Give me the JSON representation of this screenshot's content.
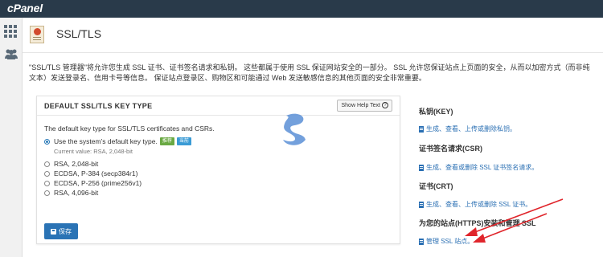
{
  "topbar": {
    "logo": "cPanel"
  },
  "header": {
    "title": "SSL/TLS"
  },
  "description": "\"SSL/TLS 管理器\"将允许您生成 SSL 证书、证书签名请求和私钥。 这些都属于使用 SSL 保证网站安全的一部分。 SSL 允许您保证站点上页面的安全，从而以加密方式（而非纯文本）发送登录名、信用卡号等信息。 保证站点登录区、购物区和可能通过 Web 发送敏感信息的其他页面的安全非常重要。",
  "panel": {
    "title": "DEFAULT SSL/TLS KEY TYPE",
    "help_label": "Show Help Text",
    "intro": "The default key type for SSL/TLS certificates and CSRs.",
    "options": [
      {
        "label": "Use the system’s default key type.",
        "selected": true
      },
      {
        "label": "RSA, 2,048-bit",
        "selected": false
      },
      {
        "label": "ECDSA, P-384 (secp384r1)",
        "selected": false
      },
      {
        "label": "ECDSA, P-256 (prime256v1)",
        "selected": false
      },
      {
        "label": "RSA, 4,096-bit",
        "selected": false
      }
    ],
    "badge_recommended": "推荐",
    "badge_current": "当前",
    "current_value": "Current value: RSA, 2,048-bit",
    "save_label": "保存"
  },
  "right": {
    "sections": [
      {
        "heading": "私钥(KEY)",
        "link": "生成、查看、上传或删除私钥。"
      },
      {
        "heading": "证书签名请求(CSR)",
        "link": "生成、查看或删除 SSL 证书签名请求。"
      },
      {
        "heading": "证书(CRT)",
        "link": "生成、查看、上传或删除 SSL 证书。"
      },
      {
        "heading": "为您的站点(HTTPS)安装和管理 SSL",
        "link": "管理 SSL 站点。"
      }
    ]
  },
  "colors": {
    "topbar": "#293a4a",
    "link": "#2a6fb3",
    "save": "#2a73b5",
    "arrow": "#e0252b"
  }
}
